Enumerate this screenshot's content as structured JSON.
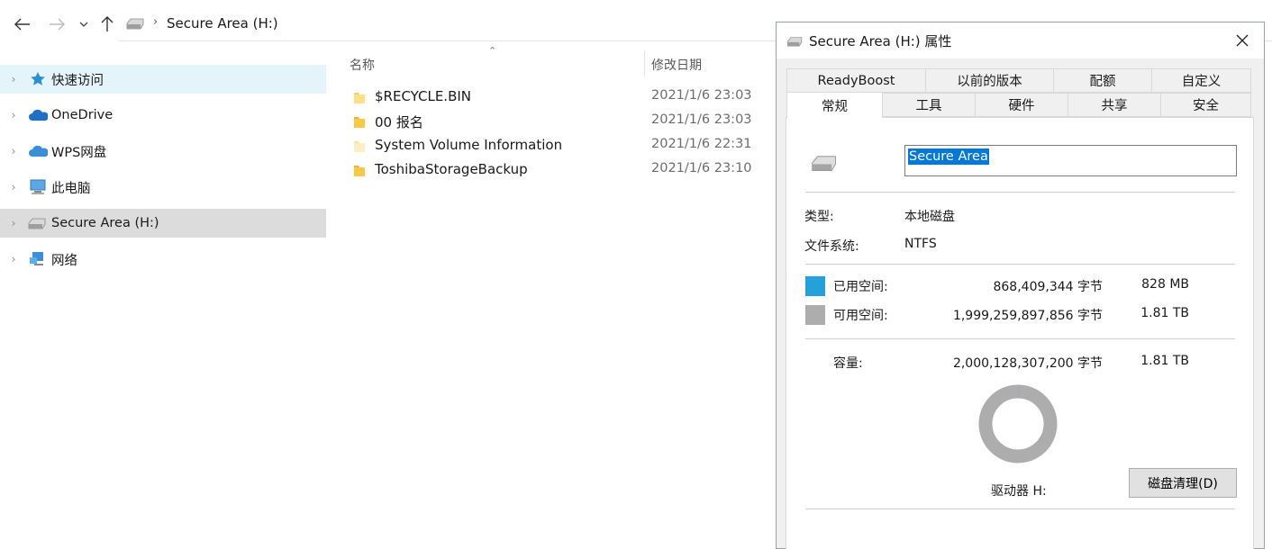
{
  "explorer": {
    "address": "Secure Area (H:)",
    "sidebar": [
      {
        "label": "快速访问",
        "icon": "star-icon"
      },
      {
        "label": "OneDrive",
        "icon": "cloud-icon"
      },
      {
        "label": "WPS网盘",
        "icon": "cloud-icon"
      },
      {
        "label": "此电脑",
        "icon": "computer-icon"
      },
      {
        "label": "Secure Area (H:)",
        "icon": "drive-icon"
      },
      {
        "label": "网络",
        "icon": "network-icon"
      }
    ],
    "columns": {
      "name": "名称",
      "date": "修改日期"
    },
    "files": [
      {
        "name": "$RECYCLE.BIN",
        "date": "2021/1/6 23:03"
      },
      {
        "name": "00 报名",
        "date": "2021/1/6 23:03"
      },
      {
        "name": "System Volume Information",
        "date": "2021/1/6 22:31"
      },
      {
        "name": "ToshibaStorageBackup",
        "date": "2021/1/6 23:10"
      }
    ]
  },
  "dialog": {
    "title": "Secure Area (H:) 属性",
    "tabs_row1": [
      "ReadyBoost",
      "以前的版本",
      "配额",
      "自定义"
    ],
    "tabs_row2": [
      "常规",
      "工具",
      "硬件",
      "共享",
      "安全"
    ],
    "volume_name": "Secure Area",
    "type_label": "类型:",
    "type_value": "本地磁盘",
    "fs_label": "文件系统:",
    "fs_value": "NTFS",
    "used_label": "已用空间:",
    "used_bytes": "868,409,344 字节",
    "used_size": "828 MB",
    "free_label": "可用空间:",
    "free_bytes": "1,999,259,897,856 字节",
    "free_size": "1.81 TB",
    "capacity_label": "容量:",
    "capacity_bytes": "2,000,128,307,200 字节",
    "capacity_size": "1.81 TB",
    "drive_label": "驱动器 H:",
    "cleanup_button": "磁盘清理(D)",
    "used_fraction": 0.000434,
    "colors": {
      "used": "#26a0da",
      "free": "#adadad"
    }
  }
}
